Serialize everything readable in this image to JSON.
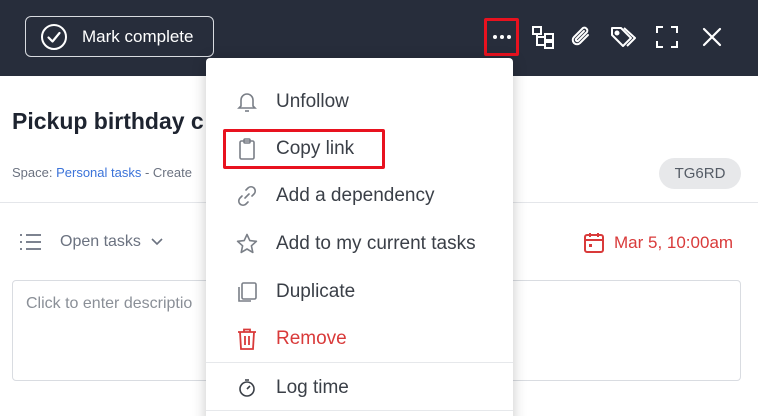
{
  "toolbar": {
    "mark_complete_label": "Mark complete",
    "icons": [
      "more-icon",
      "subtask-icon",
      "attachment-icon",
      "tag-icon",
      "expand-icon",
      "close-icon"
    ]
  },
  "task": {
    "title": "Pickup birthday c",
    "meta_prefix": "Space: ",
    "space_name": "Personal tasks",
    "meta_suffix": " - Create",
    "code": "TG6RD",
    "filter_label": "Open tasks",
    "due_date": "Mar 5, 10:00am",
    "description_placeholder": "Click to enter descriptio"
  },
  "menu": {
    "items": [
      {
        "label": "Unfollow",
        "icon": "bell-icon"
      },
      {
        "label": "Copy link",
        "icon": "clipboard-icon"
      },
      {
        "label": "Add a dependency",
        "icon": "link-icon"
      },
      {
        "label": "Add to my current tasks",
        "icon": "star-icon"
      },
      {
        "label": "Duplicate",
        "icon": "duplicate-icon"
      },
      {
        "label": "Remove",
        "icon": "trash-icon"
      },
      {
        "label": "Log time",
        "icon": "timer-icon"
      }
    ]
  },
  "colors": {
    "topbar": "#272d3b",
    "highlight": "#e8121f",
    "danger": "#d93a3a",
    "link": "#3b73d9"
  }
}
